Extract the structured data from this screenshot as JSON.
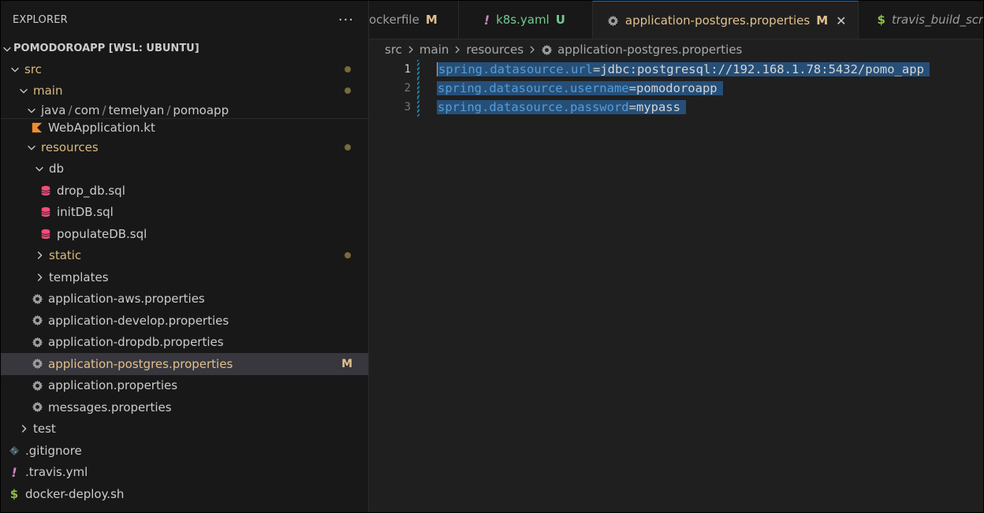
{
  "sidebar": {
    "header": "EXPLORER",
    "more": "···",
    "section": "POMODOROAPP [WSL: UBUNTU]",
    "tree": {
      "src": "src",
      "main": "main",
      "java_path": [
        "java",
        "com",
        "temelyan",
        "pomoapp"
      ],
      "web_app": "WebApplication.kt",
      "resources": "resources",
      "db": "db",
      "drop_db": "drop_db.sql",
      "init_db": "initDB.sql",
      "populate_db": "populateDB.sql",
      "static": "static",
      "templates": "templates",
      "aws": "application-aws.properties",
      "develop": "application-develop.properties",
      "dropdb": "application-dropdb.properties",
      "postgres": "application-postgres.properties",
      "postgres_badge": "M",
      "app": "application.properties",
      "messages": "messages.properties",
      "test": "test",
      "gitignore": ".gitignore",
      "travis": ".travis.yml",
      "docker_deploy": "docker-deploy.sh"
    }
  },
  "tabs": [
    {
      "label": "ockerfile",
      "status": "M"
    },
    {
      "label": "k8s.yaml",
      "status": "U"
    },
    {
      "label": "application-postgres.properties",
      "status": "M",
      "close": "✕"
    },
    {
      "label": "travis_build_script.sh",
      "status": ""
    }
  ],
  "breadcrumb": [
    "src",
    "main",
    "resources",
    "application-postgres.properties"
  ],
  "code": [
    {
      "num": "1",
      "key": "spring.datasource.url",
      "eq": "=",
      "val": "jdbc:postgresql://192.168.1.78:5432/pomo_app"
    },
    {
      "num": "2",
      "key": "spring.datasource.username",
      "eq": "=",
      "val": "pomodoroapp"
    },
    {
      "num": "3",
      "key": "spring.datasource.password",
      "eq": "=",
      "val": "mypass"
    }
  ],
  "colors": {
    "modified": "#e2c08d",
    "untracked": "#73c991",
    "selection": "#264f78",
    "key": "#569cd6",
    "db_icon": "#f14c7a",
    "kotlin_icon": "#f28b2a",
    "yaml_icon": "#c586c0",
    "shell_icon": "#8dc149"
  }
}
